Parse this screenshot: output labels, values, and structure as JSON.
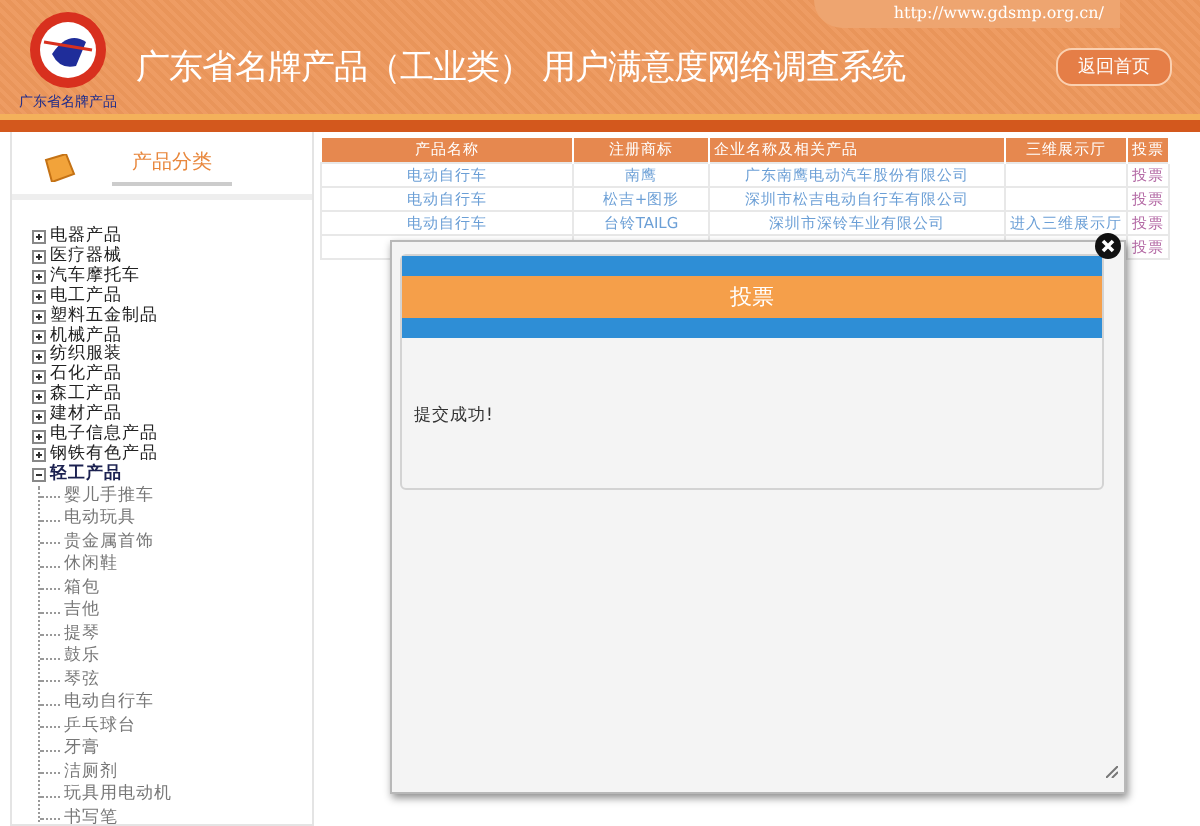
{
  "header": {
    "logo_caption": "广东省名牌产品",
    "url": "http://www.gdsmp.org.cn/",
    "title": "广东省名牌产品（工业类） 用户满意度网络调查系统",
    "home_button": "返回首页"
  },
  "sidebar": {
    "title": "产品分类",
    "items": [
      {
        "label": "电器产品",
        "expanded": false
      },
      {
        "label": "医疗器械",
        "expanded": false
      },
      {
        "label": "汽车摩托车",
        "expanded": false
      },
      {
        "label": "电工产品",
        "expanded": false
      },
      {
        "label": "塑料五金制品",
        "expanded": false
      },
      {
        "label": "机械产品",
        "expanded": false
      },
      {
        "label": "纺织服装",
        "expanded": false
      },
      {
        "label": "石化产品",
        "expanded": false
      },
      {
        "label": "森工产品",
        "expanded": false
      },
      {
        "label": "建材产品",
        "expanded": false
      },
      {
        "label": "电子信息产品",
        "expanded": false
      },
      {
        "label": "钢铁有色产品",
        "expanded": false
      },
      {
        "label": "轻工产品",
        "expanded": true,
        "children": [
          {
            "label": "婴儿手推车"
          },
          {
            "label": "电动玩具"
          },
          {
            "label": "贵金属首饰"
          },
          {
            "label": "休闲鞋"
          },
          {
            "label": "箱包"
          },
          {
            "label": "吉他"
          },
          {
            "label": "提琴"
          },
          {
            "label": "鼓乐"
          },
          {
            "label": "琴弦"
          },
          {
            "label": "电动自行车"
          },
          {
            "label": "乒乓球台"
          },
          {
            "label": "牙膏"
          },
          {
            "label": "洁厕剂"
          },
          {
            "label": "玩具用电动机"
          },
          {
            "label": "书写笔"
          }
        ]
      }
    ]
  },
  "table": {
    "columns": [
      "产品名称",
      "注册商标",
      "企业名称及相关产品",
      "三维展示厅",
      "投票"
    ],
    "rows": [
      {
        "cells": [
          "电动自行车",
          "南鹰",
          "广东南鹰电动汽车股份有限公司",
          "",
          "投票"
        ]
      },
      {
        "cells": [
          "电动自行车",
          "松吉+图形",
          "深圳市松吉电动自行车有限公司",
          "",
          "投票"
        ]
      },
      {
        "cells": [
          "电动自行车",
          "台铃TAILG",
          "深圳市深铃车业有限公司",
          "进入三维展示厅",
          "投票"
        ]
      },
      {
        "cells": [
          "",
          "",
          "",
          "",
          "投票"
        ]
      }
    ]
  },
  "dialog": {
    "title": "投票",
    "message": "提交成功!"
  }
}
